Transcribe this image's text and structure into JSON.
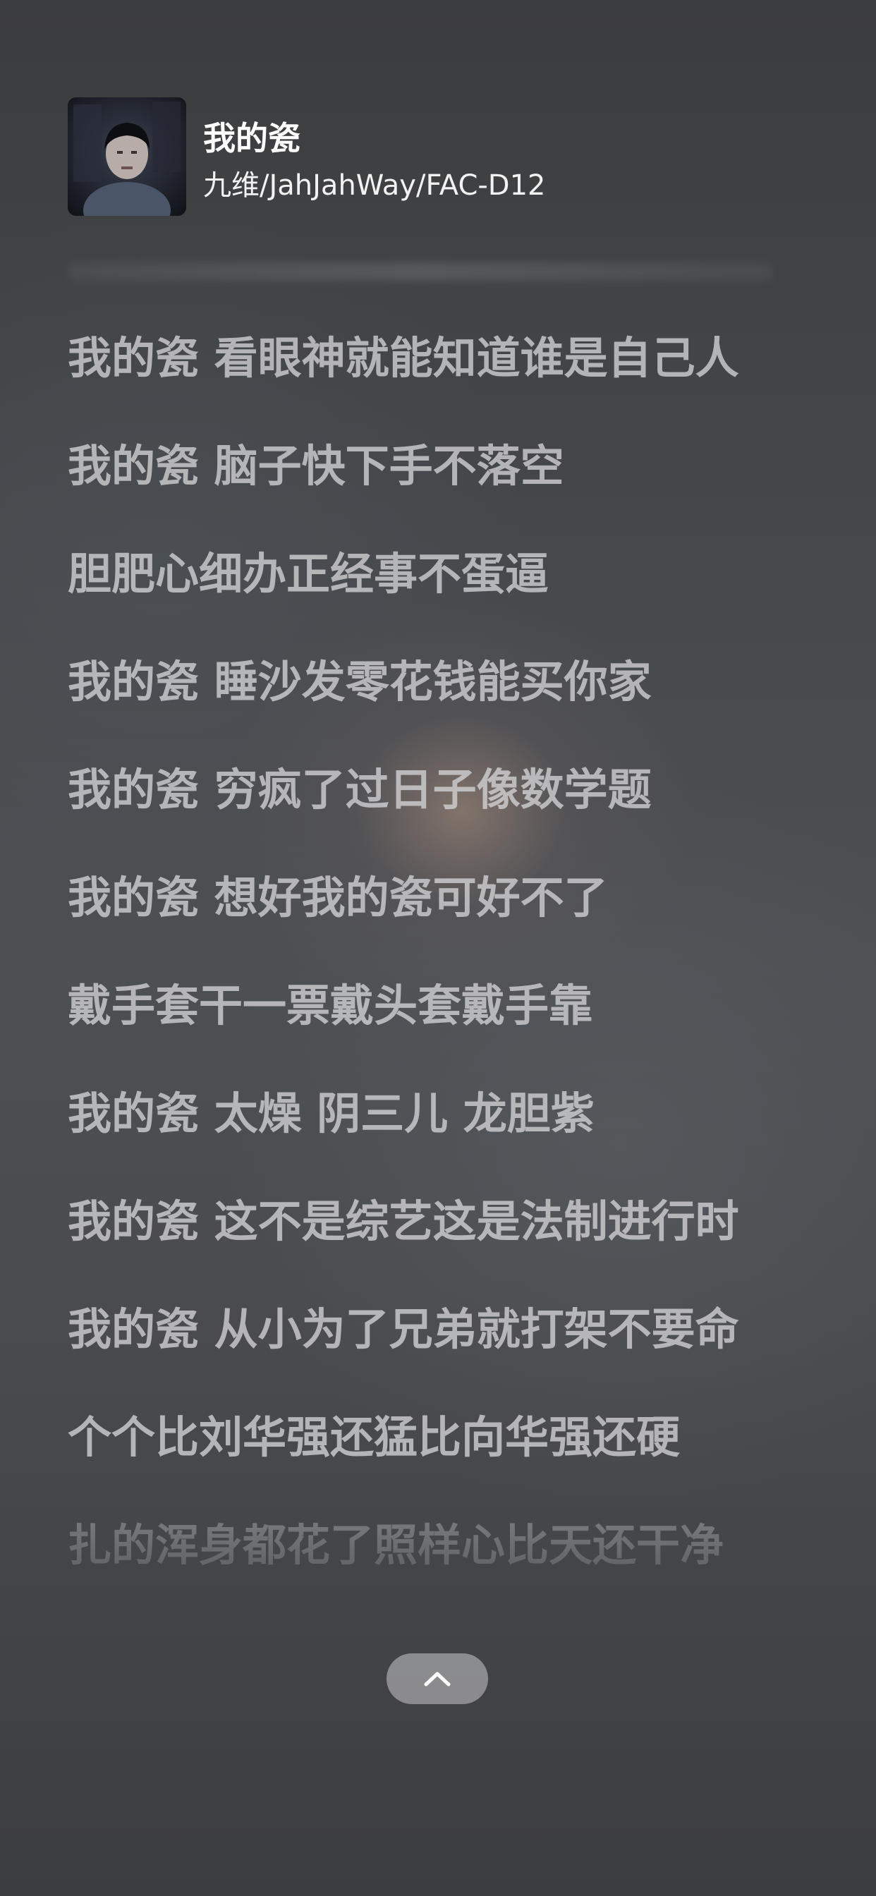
{
  "now_playing": {
    "title": "我的瓷",
    "artist": "九维/JahJahWay/FAC-D12"
  },
  "lyrics": [
    "我的瓷 看眼神就能知道谁是自己人",
    "我的瓷 脑子快下手不落空",
    "胆肥心细办正经事不蛋逼",
    "我的瓷 睡沙发零花钱能买你家",
    "我的瓷 穷疯了过日子像数学题",
    "我的瓷 想好我的瓷可好不了",
    "戴手套干一票戴头套戴手靠",
    "我的瓷 太燥 阴三儿 龙胆紫",
    "我的瓷 这不是综艺这是法制进行时",
    "我的瓷 从小为了兄弟就打架不要命",
    "个个比刘华强还猛比向华强还硬",
    "扎的浑身都花了照样心比天还干净"
  ],
  "controls": {
    "collapse_icon": "chevron-up-icon"
  }
}
